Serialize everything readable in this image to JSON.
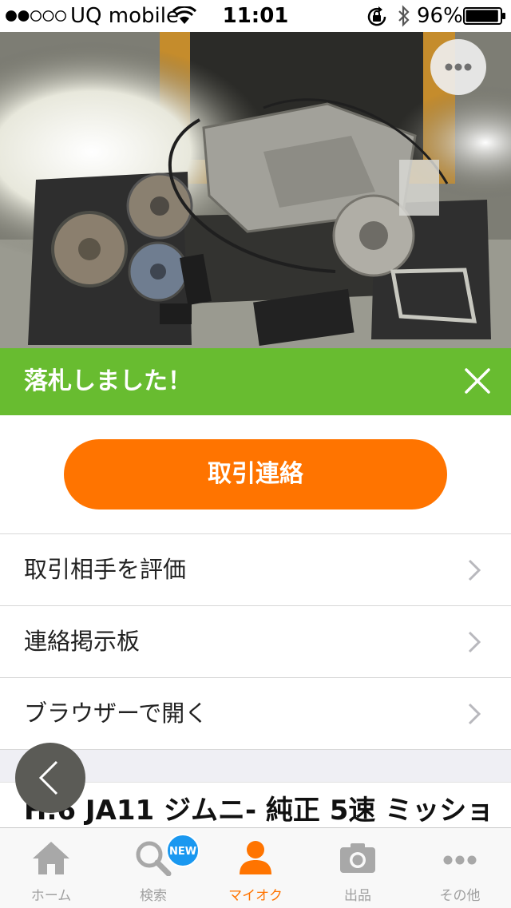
{
  "status_bar": {
    "signal_strength": 2,
    "signal_max": 5,
    "carrier": "UQ mobile",
    "time": "11:01",
    "battery_percent": "96%",
    "battery_level": 0.96
  },
  "photo": {
    "more_icon": "more-horizontal-icon"
  },
  "banner": {
    "text": "落札しました！",
    "close_icon": "close-icon",
    "color": "#68bc30"
  },
  "primary_action": {
    "label": "取引連絡",
    "color": "#ff7400"
  },
  "menu": [
    {
      "label": "取引相手を評価",
      "icon": "chevron-right-icon"
    },
    {
      "label": "連絡掲示板",
      "icon": "chevron-right-icon"
    },
    {
      "label": "ブラウザーで開く",
      "icon": "chevron-right-icon"
    }
  ],
  "item": {
    "title": "H.6 JA11 ジムニ- 純正 5速 ミッショ"
  },
  "back_button": {
    "icon": "chevron-left-icon"
  },
  "tabbar": {
    "active_color": "#ff7400",
    "inactive_color": "#a0a0a0",
    "badge_color": "#1a98f0",
    "tabs": [
      {
        "label": "ホーム",
        "icon": "home-icon"
      },
      {
        "label": "検索",
        "icon": "search-icon",
        "badge": "NEW"
      },
      {
        "label": "マイオク",
        "icon": "person-icon",
        "active": true
      },
      {
        "label": "出品",
        "icon": "camera-icon"
      },
      {
        "label": "その他",
        "icon": "more-icon"
      }
    ]
  }
}
